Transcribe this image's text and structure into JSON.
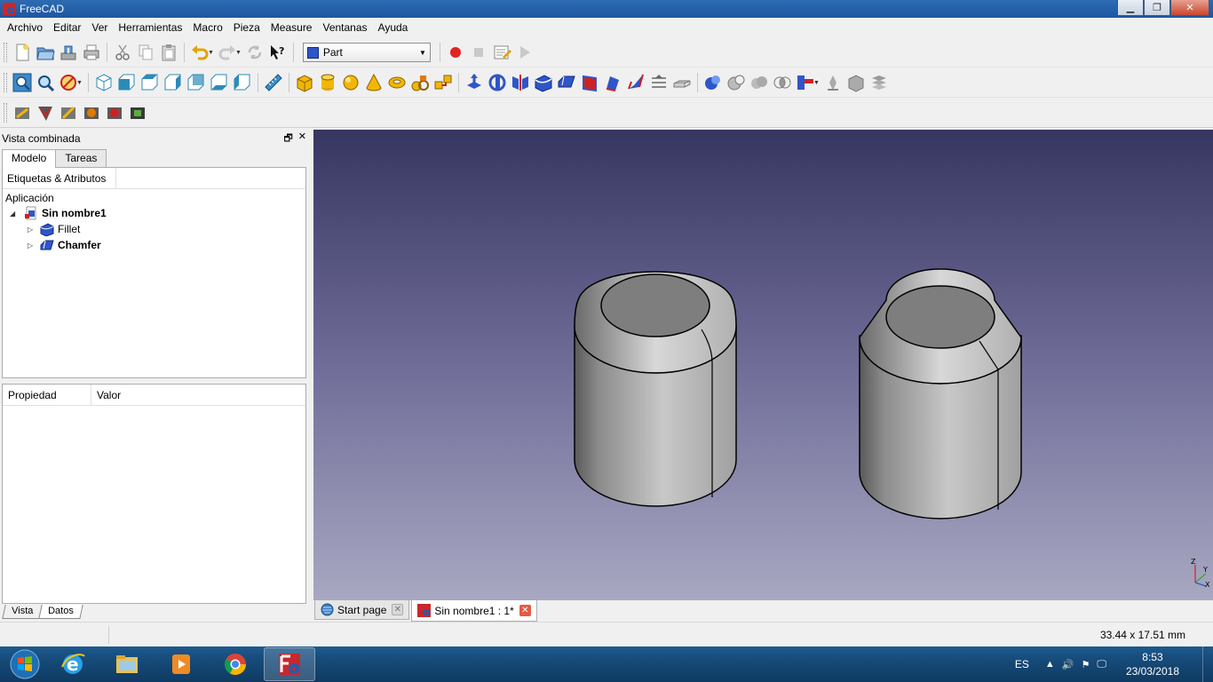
{
  "window": {
    "title": "FreeCAD"
  },
  "menu": [
    "Archivo",
    "Editar",
    "Ver",
    "Herramientas",
    "Macro",
    "Pieza",
    "Measure",
    "Ventanas",
    "Ayuda"
  ],
  "workbench": {
    "selected": "Part"
  },
  "combo": {
    "title": "Vista combinada",
    "tabs": [
      "Modelo",
      "Tareas"
    ],
    "tree_header": "Etiquetas & Atributos",
    "app_label": "Aplicación",
    "document": "Sin nombre1",
    "items": [
      "Fillet",
      "Chamfer"
    ]
  },
  "properties": {
    "col_property": "Propiedad",
    "col_value": "Valor",
    "tabs": [
      "Vista",
      "Datos"
    ]
  },
  "doc_tabs": [
    {
      "label": "Start page"
    },
    {
      "label": "Sin nombre1 : 1*"
    }
  ],
  "axis": {
    "z": "Z",
    "y": "Y",
    "x": "X"
  },
  "status": {
    "dimensions": "33.44 x 17.51 mm"
  },
  "taskbar": {
    "lang": "ES",
    "time": "8:53",
    "date": "23/03/2018"
  },
  "icons": {
    "toolbar_file": [
      "new-file-icon",
      "open-icon",
      "save-icon",
      "print-icon",
      "cut-icon",
      "copy-icon",
      "paste-icon",
      "undo-icon",
      "redo-icon",
      "refresh-icon",
      "whats-this-icon"
    ],
    "macro": [
      "record-macro-icon",
      "stop-macro-icon",
      "edit-macro-icon",
      "run-macro-icon"
    ],
    "colors": {
      "viewport_top": "#373661",
      "viewport_bottom": "#a8a8c2",
      "part_blue": "#2f56c9",
      "primitive_yellow": "#f2b705"
    }
  }
}
